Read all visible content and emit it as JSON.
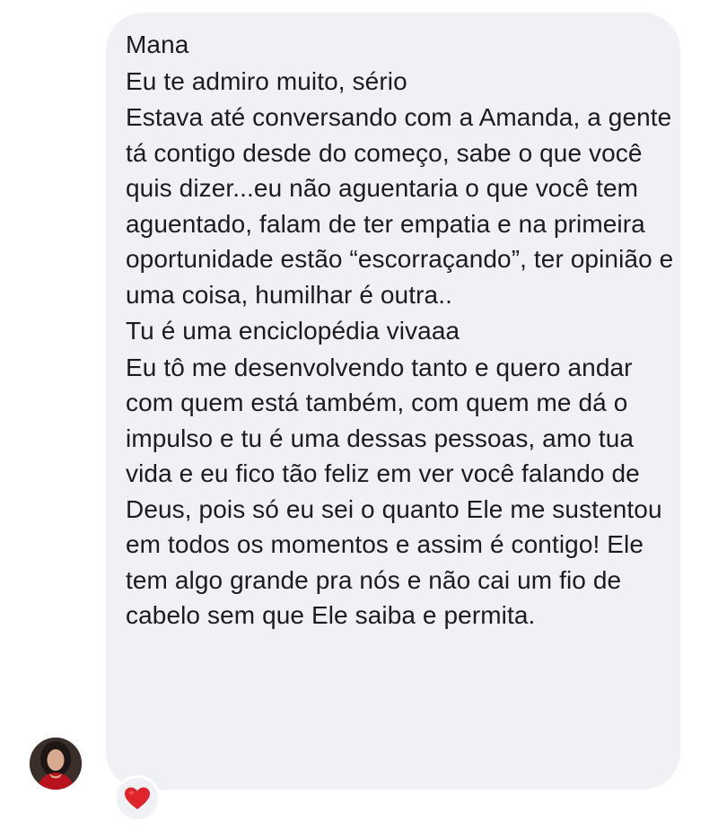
{
  "thread": {
    "messages": [
      "Mana",
      "Eu te admiro muito, sério",
      "Estava até conversando com a Amanda, a gente tá contigo desde do começo, sabe o que você quis dizer...eu não aguentaria o que você tem aguentado, falam de ter empatia e na primeira oportunidade estão “escorraçando”, ter opinião e uma coisa, humilhar é outra..",
      "Tu é uma enciclopédia vivaaa",
      "Eu tô me desenvolvendo tanto e quero andar com quem está também, com quem me dá o impulso e tu é uma dessas pessoas, amo tua vida e eu fico tão feliz em ver você falando de Deus, pois só eu sei o quanto Ele me sustentou em todos os momentos e assim é contigo! Ele tem algo grande pra nós e não cai um fio de cabelo sem que Ele saiba e permita."
    ],
    "reaction": {
      "icon": "heart-icon",
      "color": "#e0242e"
    },
    "colors": {
      "bubble": "#eff1f5",
      "text": "#1c1c1e",
      "background": "#ffffff"
    }
  }
}
